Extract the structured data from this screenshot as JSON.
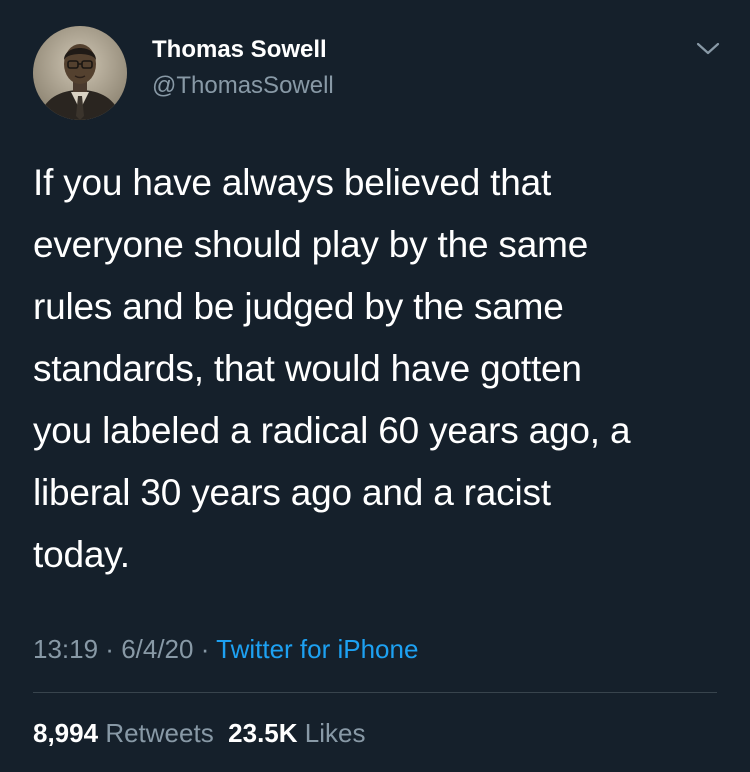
{
  "author": {
    "display_name": "Thomas Sowell",
    "handle": "@ThomasSowell",
    "avatar_icon": "profile-photo"
  },
  "tweet": {
    "lines": [
      "If you have always believed that",
      "everyone should play by the same",
      "rules and be judged by the same",
      "standards, that would have gotten",
      "you labeled a radical 60 years ago, a",
      "liberal 30 years ago and a racist",
      "today."
    ]
  },
  "meta": {
    "time": "13:19",
    "separator": " · ",
    "date": "6/4/20",
    "source": "Twitter for iPhone"
  },
  "stats": {
    "retweets_count": "8,994",
    "retweets_label": "Retweets",
    "likes_count": "23.5K",
    "likes_label": "Likes"
  },
  "colors": {
    "background": "#15202b",
    "secondary_text": "#8899a6",
    "link": "#1da1f2",
    "divider": "#38444d"
  },
  "icons": {
    "more": "chevron-down-icon"
  }
}
